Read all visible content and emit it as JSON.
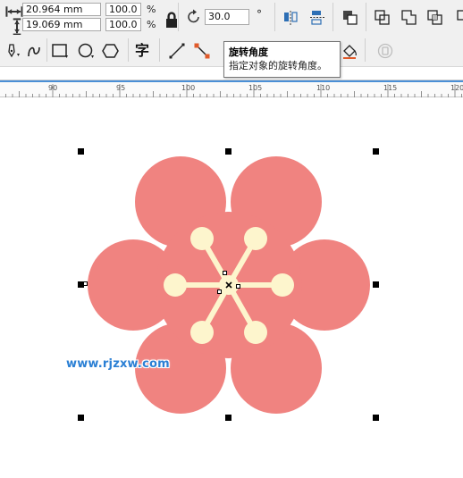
{
  "property_bar": {
    "width_value": "20.964 mm",
    "height_value": "19.069 mm",
    "scale_x_value": "100.0",
    "scale_y_value": "100.0",
    "percent_symbol": "%",
    "rotation_value": "30.0",
    "degree_symbol": "°"
  },
  "tooltip": {
    "title": "旋转角度",
    "description": "指定对象的旋转角度。"
  },
  "toolbar2": {
    "text_tool_glyph": "字"
  },
  "ruler": {
    "labels": [
      "90",
      "95",
      "100",
      "105",
      "110",
      "115",
      "120"
    ]
  },
  "canvas": {
    "watermark": "www.rjzxw.com",
    "colors": {
      "petal": "#f08380",
      "stamen": "#fdf5cd",
      "handle": "#000000"
    }
  },
  "icons": [
    "width-arrows-icon",
    "height-arrows-icon",
    "lock-ratio-icon",
    "rotate-icon",
    "mirror-horizontal-icon",
    "mirror-vertical-icon",
    "arrange-order-icon",
    "combine-icon",
    "weld-icon",
    "trim-icon",
    "intersect-icon",
    "pen-tool-icon",
    "curve-tool-icon",
    "rectangle-tool-icon",
    "ellipse-tool-icon",
    "polygon-tool-icon",
    "text-tool-icon",
    "line-tool-icon",
    "connector-tool-icon",
    "fill-bucket-icon",
    "transparency-icon"
  ]
}
